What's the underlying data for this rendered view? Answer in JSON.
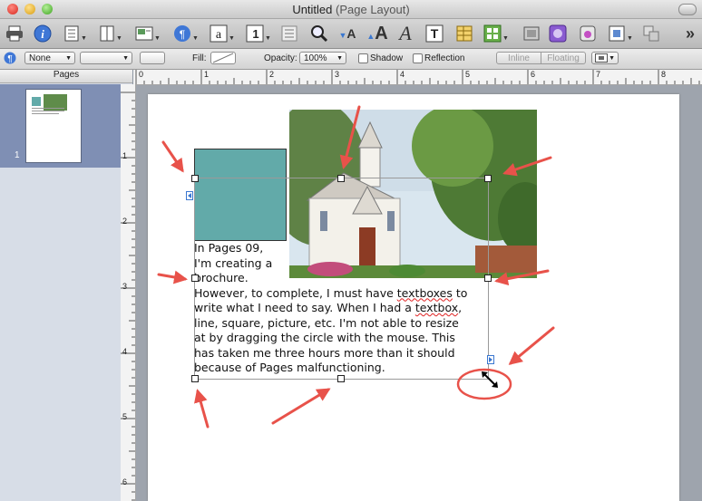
{
  "window": {
    "title": "Untitled",
    "subtitle": "(Page Layout)"
  },
  "toolbar": {
    "overflow_label": "»",
    "icons": [
      "printer-icon",
      "info-icon",
      "sections-icon",
      "view-icon",
      "insert-icon",
      "styles-icon",
      "text-icon",
      "comment-icon",
      "list-icon",
      "zoom-icon",
      "text-smaller-icon",
      "text-bigger-icon",
      "fonts-icon",
      "textbox-icon",
      "table-icon",
      "chart-icon",
      "shapes-icon",
      "media-icon",
      "front-icon",
      "back-icon",
      "wrap-icon"
    ]
  },
  "format_bar": {
    "paragraph_style": "None",
    "fill_label": "Fill:",
    "opacity_label": "Opacity:",
    "opacity_value": "100%",
    "shadow_label": "Shadow",
    "reflection_label": "Reflection",
    "inline_label": "Inline",
    "floating_label": "Floating"
  },
  "sidebar": {
    "header": "Pages",
    "page_number": "1"
  },
  "rulers": {
    "horizontal": [
      "0",
      "1",
      "2",
      "3",
      "4",
      "5",
      "6",
      "7",
      "8"
    ],
    "vertical": [
      "1",
      "2",
      "3",
      "4",
      "5",
      "6"
    ]
  },
  "document": {
    "text_before": "In Pages 09,\nI'm creating a\nbrochure.\nHowever, to complete, I must have ",
    "word_textboxes": "textboxes",
    "text_middle": " to\nwrite what I need to say. When I had a ",
    "word_textbox": "textbox",
    "text_after": ",\nline, square, picture, etc. I'm not able to resize\nat by dragging the circle with the mouse. This\nhas taken me three hours more than it should\nbecause of Pages malfunctioning."
  },
  "colors": {
    "teal_box": "#62aaa9",
    "annotation": "#e8524a",
    "thumbnail_selected": "#7f8fb4"
  }
}
